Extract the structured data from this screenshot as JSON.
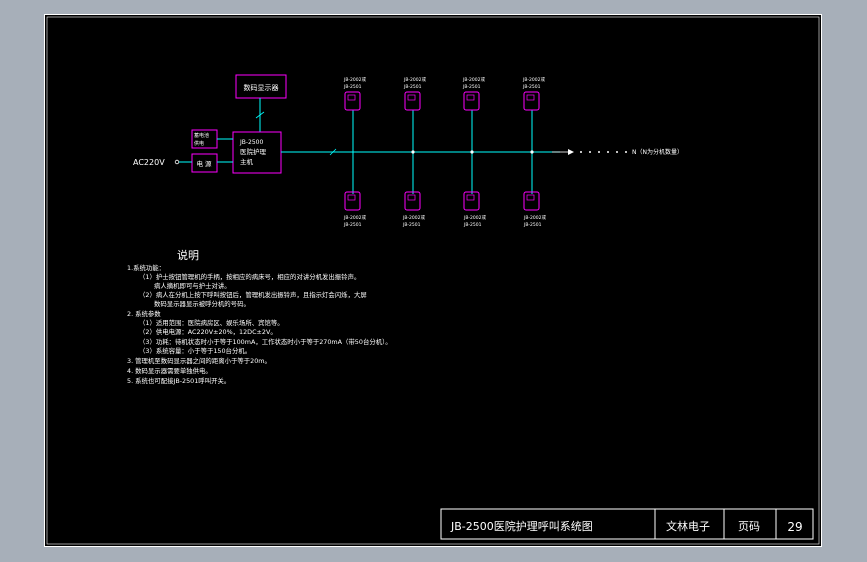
{
  "diagram": {
    "display_box_label": "数码显示器",
    "host_lines": [
      "JB-2500",
      "医院护理",
      "主机"
    ],
    "power_box_label": "电  源",
    "backup_lines": [
      "蓄电池",
      "供电"
    ],
    "ac_label": "AC220V",
    "top_units": [
      {
        "lines": [
          "JB-2002或",
          "JB-2501"
        ]
      },
      {
        "lines": [
          "JB-2002或",
          "JB-2501"
        ]
      },
      {
        "lines": [
          "JB-2002或",
          "JB-2501"
        ]
      },
      {
        "lines": [
          "JB-2002或",
          "JB-2501"
        ]
      }
    ],
    "bottom_units": [
      {
        "lines": [
          "JB-2002或",
          "JB-2501"
        ]
      },
      {
        "lines": [
          "JB-2002或",
          "JB-2501"
        ]
      },
      {
        "lines": [
          "JB-2002或",
          "JB-2501"
        ]
      },
      {
        "lines": [
          "JB-2002或",
          "JB-2501"
        ]
      }
    ],
    "continuation_label": "N（N为分机数量）"
  },
  "notes": {
    "heading": "说明",
    "lines": [
      "1.系统功能：",
      "（1）护士按钮管理机的手柄，按相应的病床号，相应的对讲分机发出振铃声。",
      "病人摘机即可与护士对讲。",
      "（2）病人在分机上按下呼叫按钮后，管理机发出振铃声，且指示灯会闪烁，大屏",
      "数码显示器显示被呼分机的号码。",
      "2. 系统参数",
      "（1）适用范围：医院病房区、娱乐场所、宾馆等。",
      "（2）供电电源：AC220V±20%，12DC±2V。",
      "（3）功耗：待机状态时小于等于100mA，工作状态时小于等于270mA（带50台分机）。",
      "（3）系统容量：小于等于150台分机。",
      "3. 管理机至数码显示器之间的距离小于等于20m。",
      "4. 数码显示器需要单独供电。",
      "5. 系统也可配接JB-2501呼叫开关。"
    ]
  },
  "title_block": {
    "drawing_title": "JB-2500医院护理呼叫系统图",
    "company": "文林电子",
    "page_label": "页码",
    "page_number": "29"
  },
  "colors": {
    "sheet": "#000000",
    "border": "#ffffff",
    "box": "#ff00ff",
    "bus": "#00ffff",
    "notes_text": "#ffffff"
  }
}
